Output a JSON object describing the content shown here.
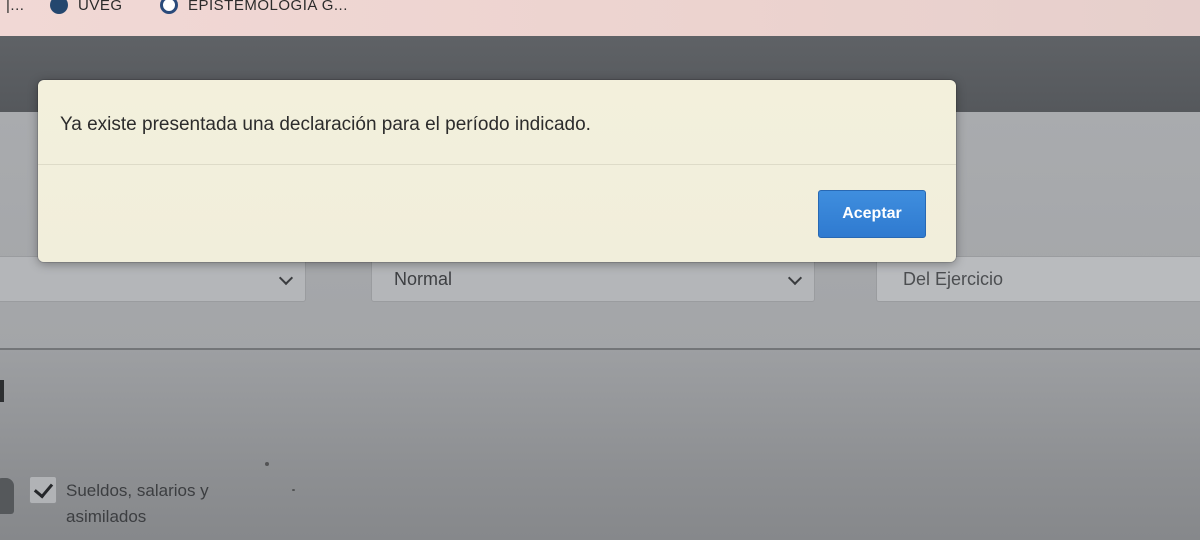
{
  "bookmarks": {
    "apps_label": "|...",
    "uveg_label": "UVEG",
    "epistemologia_label": "EPISTEMOLOGIA G..."
  },
  "form": {
    "select_tipo_value": "Normal",
    "field_periodo_value": "Del Ejercicio"
  },
  "income_options": {
    "sueldos_label": "Sueldos, salarios y asimilados",
    "sueldos_checked": true
  },
  "dialog": {
    "message": "Ya existe presentada una declaración para el período indicado.",
    "accept_label": "Aceptar"
  },
  "colors": {
    "dialog_background": "#f2efdb",
    "accept_button": "#3585d6",
    "bookmarks_bar": "#ecd3cf"
  }
}
